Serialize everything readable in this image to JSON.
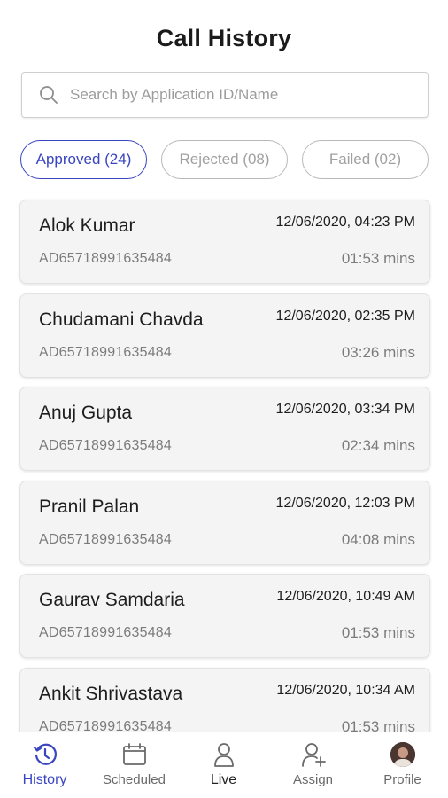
{
  "header": {
    "title": "Call History"
  },
  "search": {
    "placeholder": "Search by Application ID/Name",
    "value": ""
  },
  "filters": [
    {
      "label": "Approved (24)",
      "active": true
    },
    {
      "label": "Rejected (08)",
      "active": false
    },
    {
      "label": "Failed (02)",
      "active": false
    }
  ],
  "calls": [
    {
      "name": "Alok Kumar",
      "datetime": "12/06/2020, 04:23 PM",
      "app_id": "AD65718991635484",
      "duration": "01:53 mins"
    },
    {
      "name": "Chudamani Chavda",
      "datetime": "12/06/2020, 02:35 PM",
      "app_id": "AD65718991635484",
      "duration": "03:26 mins"
    },
    {
      "name": "Anuj Gupta",
      "datetime": "12/06/2020, 03:34 PM",
      "app_id": "AD65718991635484",
      "duration": "02:34 mins"
    },
    {
      "name": "Pranil Palan",
      "datetime": "12/06/2020, 12:03 PM",
      "app_id": "AD65718991635484",
      "duration": "04:08 mins"
    },
    {
      "name": "Gaurav Samdaria",
      "datetime": "12/06/2020, 10:49 AM",
      "app_id": "AD65718991635484",
      "duration": "01:53 mins"
    },
    {
      "name": "Ankit Shrivastava",
      "datetime": "12/06/2020, 10:34 AM",
      "app_id": "AD65718991635484",
      "duration": "01:53 mins"
    }
  ],
  "nav": [
    {
      "label": "History",
      "icon": "history-clock-icon",
      "active": true
    },
    {
      "label": "Scheduled",
      "icon": "calendar-icon",
      "active": false
    },
    {
      "label": "Live",
      "icon": "user-icon",
      "active": false
    },
    {
      "label": "Assign",
      "icon": "add-user-icon",
      "active": false
    },
    {
      "label": "Profile",
      "icon": "avatar",
      "active": false
    }
  ],
  "colors": {
    "accent": "#3a45c0",
    "card_bg": "#f4f4f4",
    "muted_text": "#7b7b7b"
  }
}
